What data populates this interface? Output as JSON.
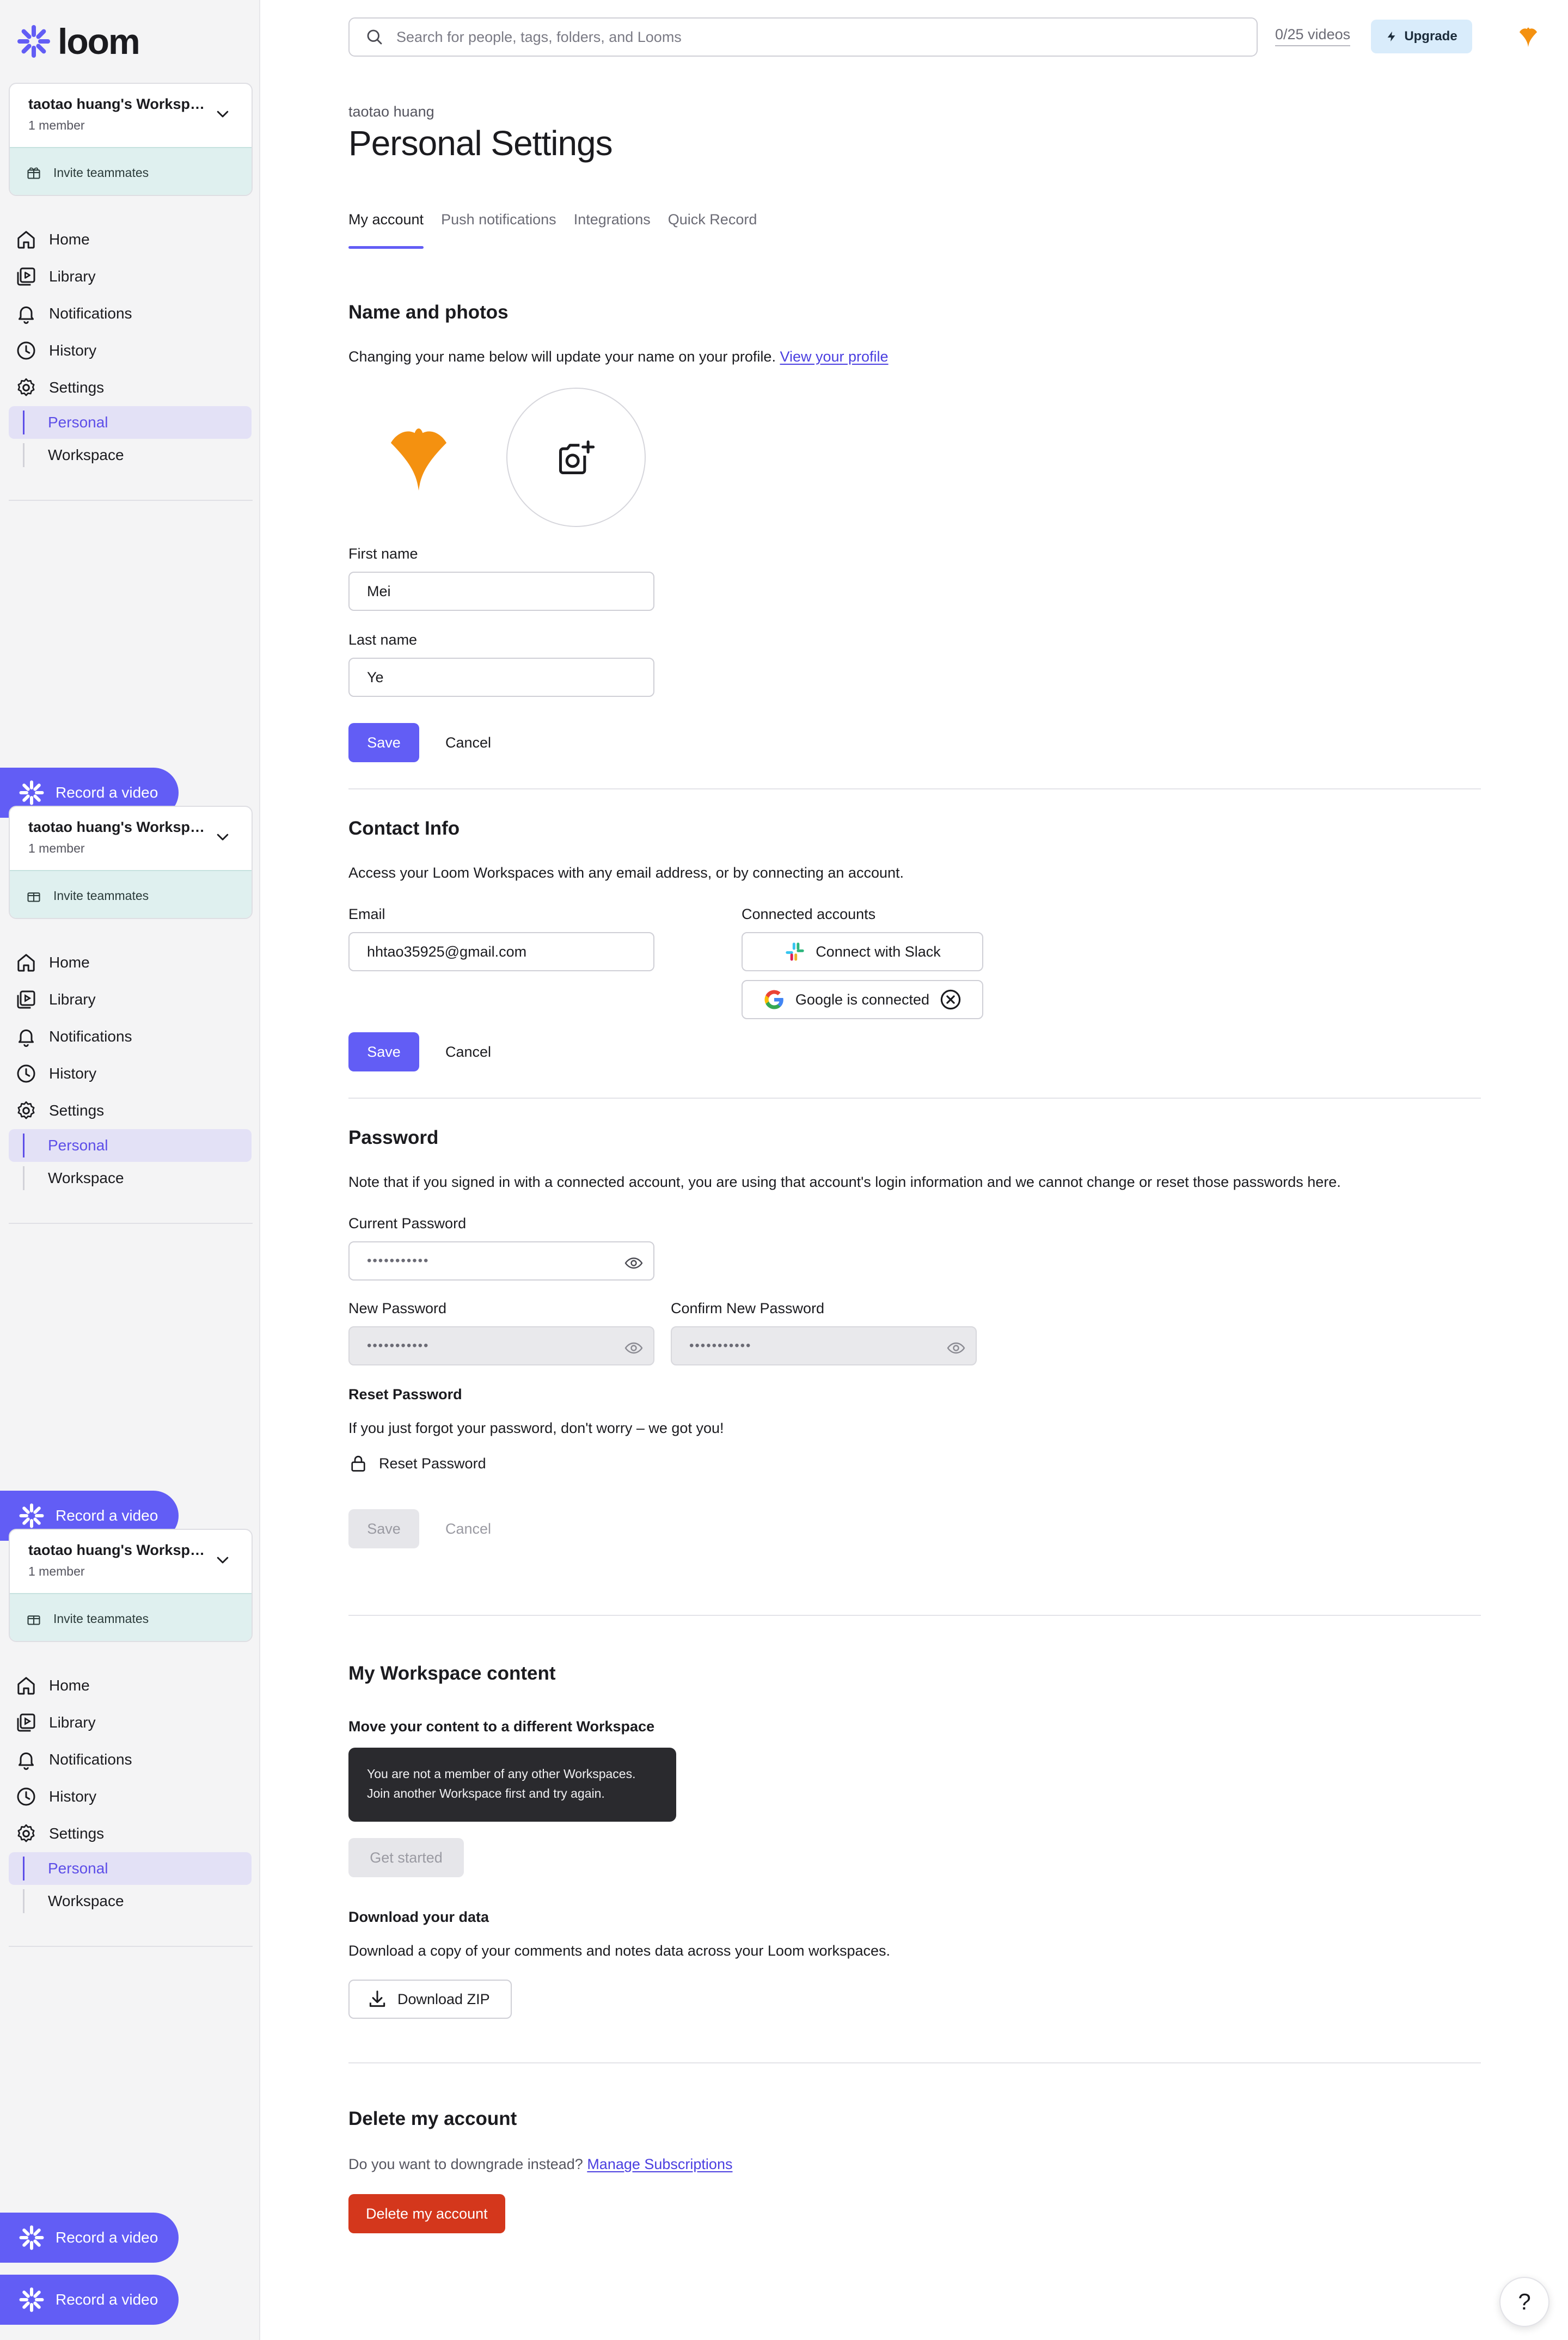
{
  "brand": {
    "name": "loom",
    "accent": "#625df5"
  },
  "sidebar": {
    "workspace_name": "taotao huang's Workspace",
    "workspace_members": "1 member",
    "invite_label": "Invite teammates",
    "nav": [
      {
        "label": "Home",
        "icon": "home-icon"
      },
      {
        "label": "Library",
        "icon": "library-icon"
      },
      {
        "label": "Notifications",
        "icon": "bell-icon"
      },
      {
        "label": "History",
        "icon": "clock-icon"
      },
      {
        "label": "Settings",
        "icon": "gear-icon"
      }
    ],
    "settings_sub": [
      {
        "label": "Personal",
        "active": true
      },
      {
        "label": "Workspace",
        "active": false
      }
    ],
    "record_label": "Record a video"
  },
  "topbar": {
    "search_placeholder": "Search for people, tags, folders, and Looms",
    "video_count": "0/25 videos",
    "upgrade_label": "Upgrade"
  },
  "header": {
    "breadcrumb": "taotao huang",
    "title": "Personal Settings"
  },
  "tabs": [
    "My account",
    "Push notifications",
    "Integrations",
    "Quick Record"
  ],
  "name_photos": {
    "title": "Name and photos",
    "description": "Changing your name below will update your name on your profile.",
    "profile_link": "View your profile",
    "first_name_label": "First name",
    "first_name_value": "Mei",
    "last_name_label": "Last name",
    "last_name_value": "Ye",
    "save_label": "Save",
    "cancel_label": "Cancel"
  },
  "contact": {
    "title": "Contact Info",
    "description": "Access your Loom Workspaces with any email address, or by connecting an account.",
    "email_label": "Email",
    "email_value": "hhtao35925@gmail.com",
    "connected_label": "Connected accounts",
    "slack_label": "Connect with Slack",
    "google_label": "Google is connected",
    "save_label": "Save",
    "cancel_label": "Cancel"
  },
  "password": {
    "title": "Password",
    "note": "Note that if you signed in with a connected account, you are using that account's login information and we cannot change or reset those passwords here.",
    "current_label": "Current Password",
    "new_label": "New Password",
    "confirm_label": "Confirm New Password",
    "masked": "•••••••••••",
    "reset_heading": "Reset Password",
    "reset_text": "If you just forgot your password, don't worry – we got you!",
    "reset_link": "Reset Password",
    "save_label": "Save",
    "cancel_label": "Cancel"
  },
  "workspace_content": {
    "title": "My Workspace content",
    "move_heading": "Move your content to a different Workspace",
    "tooltip_line1": "You are not a member of any other Workspaces.",
    "tooltip_line2": "Join another Workspace first and try again.",
    "get_started_label": "Get started",
    "download_heading": "Download your data",
    "download_text": "Download a copy of your comments and notes data across your Loom workspaces.",
    "download_label": "Download ZIP"
  },
  "delete": {
    "title": "Delete my account",
    "question": "Do you want to downgrade instead?",
    "manage_link": "Manage Subscriptions",
    "delete_label": "Delete my account"
  },
  "help_label": "?"
}
